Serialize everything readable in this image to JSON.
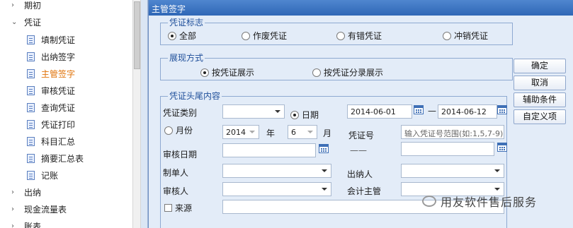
{
  "nav": {
    "top_before": [
      {
        "label": "期初",
        "arrow": "›"
      },
      {
        "label": "凭证",
        "arrow": "⌄"
      }
    ],
    "sub_items": [
      {
        "label": "填制凭证",
        "active": false
      },
      {
        "label": "出纳签字",
        "active": false
      },
      {
        "label": "主管签字",
        "active": true
      },
      {
        "label": "审核凭证",
        "active": false
      },
      {
        "label": "查询凭证",
        "active": false
      },
      {
        "label": "凭证打印",
        "active": false
      },
      {
        "label": "科目汇总",
        "active": false
      },
      {
        "label": "摘要汇总表",
        "active": false
      },
      {
        "label": "记账",
        "active": false
      }
    ],
    "top_after": [
      {
        "label": "出纳",
        "arrow": "›"
      },
      {
        "label": "现金流量表",
        "arrow": "›"
      },
      {
        "label": "账表",
        "arrow": "›"
      }
    ]
  },
  "dialog": {
    "title": "主管签字",
    "voucher_flag": {
      "legend": "凭证标志",
      "options": [
        {
          "label": "全部",
          "selected": true
        },
        {
          "label": "作废凭证",
          "selected": false
        },
        {
          "label": "有错凭证",
          "selected": false
        },
        {
          "label": "冲销凭证",
          "selected": false
        }
      ]
    },
    "display_mode": {
      "legend": "展现方式",
      "options": [
        {
          "label": "按凭证展示",
          "selected": true
        },
        {
          "label": "按凭证分录展示",
          "selected": false
        }
      ]
    },
    "header_tail": {
      "legend": "凭证头尾内容",
      "voucher_type_label": "凭证类别",
      "voucher_type_value": "",
      "date_radio_label": "日期",
      "date_radio_selected": true,
      "date_from": "2014-06-01",
      "date_sep": "—",
      "date_to": "2014-06-12",
      "month_radio_label": "月份",
      "month_radio_selected": false,
      "year_value": "2014",
      "year_unit": "年",
      "month_value": "6",
      "month_unit": "月",
      "voucher_no_label": "凭证号",
      "voucher_no_placeholder": "输入凭证号范围(如:1,5,7-9)",
      "audit_date_label": "审核日期",
      "audit_date_from": "",
      "audit_date_sep": "——",
      "audit_date_to": "",
      "maker_label": "制单人",
      "maker_value": "",
      "cashier_label": "出纳人",
      "cashier_value": "",
      "auditor_label": "审核人",
      "auditor_value": "",
      "supervisor_label": "会计主管",
      "supervisor_value": "",
      "source_label": "来源",
      "source_checked": false,
      "source_value": ""
    },
    "buttons": {
      "ok": "确定",
      "cancel": "取消",
      "aux": "辅助条件",
      "custom": "自定义项"
    }
  },
  "watermark": {
    "text": "用友软件售后服务",
    "icon": "wechat-icon"
  }
}
